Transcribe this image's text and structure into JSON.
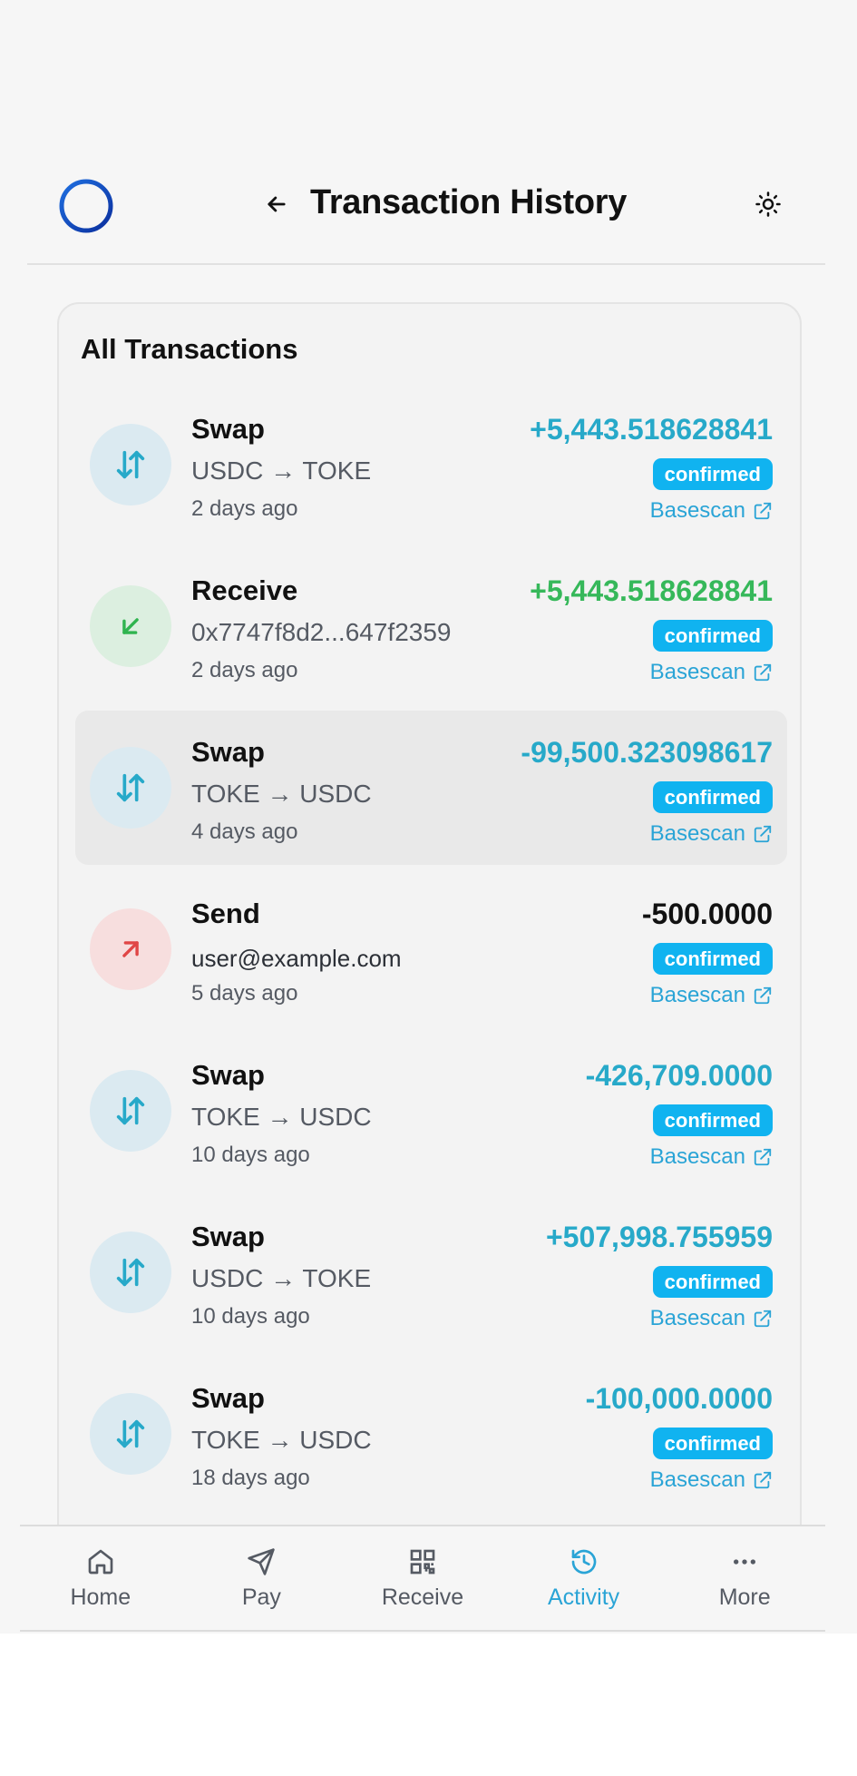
{
  "header": {
    "title": "Transaction History",
    "logo_icon": "token-logo-icon",
    "back_icon": "arrow-left-icon",
    "theme_icon": "sun-icon"
  },
  "card": {
    "title": "All Transactions"
  },
  "colors": {
    "accent": "#2aa4d6",
    "positive": "#36b85a",
    "swap_amount": "#27a9c9",
    "status_badge": "#10b3f0",
    "send_icon": "#e04646",
    "receive_icon": "#2fb44f"
  },
  "transactions": [
    {
      "type": "Swap",
      "detail": "USDC → TOKE",
      "time": "2 days ago",
      "amount": "+5,443.518628841",
      "status": "confirmed",
      "link": "Basescan",
      "icon": "swap-arrows-icon"
    },
    {
      "type": "Receive",
      "detail": "0x7747f8d2...647f2359",
      "time": "2 days ago",
      "amount": "+5,443.518628841",
      "status": "confirmed",
      "link": "Basescan",
      "icon": "arrow-down-left-icon"
    },
    {
      "type": "Swap",
      "detail": "TOKE → USDC",
      "time": "4 days ago",
      "amount": "-99,500.323098617",
      "status": "confirmed",
      "link": "Basescan",
      "icon": "swap-arrows-icon"
    },
    {
      "type": "Send",
      "detail": "user@example.com",
      "time": "5 days ago",
      "amount": "-500.0000",
      "status": "confirmed",
      "link": "Basescan",
      "icon": "arrow-up-right-icon"
    },
    {
      "type": "Swap",
      "detail": "TOKE → USDC",
      "time": "10 days ago",
      "amount": "-426,709.0000",
      "status": "confirmed",
      "link": "Basescan",
      "icon": "swap-arrows-icon"
    },
    {
      "type": "Swap",
      "detail": "USDC → TOKE",
      "time": "10 days ago",
      "amount": "+507,998.755959",
      "status": "confirmed",
      "link": "Basescan",
      "icon": "swap-arrows-icon"
    },
    {
      "type": "Swap",
      "detail": "TOKE → USDC",
      "time": "18 days ago",
      "amount": "-100,000.0000",
      "status": "confirmed",
      "link": "Basescan",
      "icon": "swap-arrows-icon"
    }
  ],
  "nav": {
    "items": [
      {
        "label": "Home",
        "icon": "home-icon"
      },
      {
        "label": "Pay",
        "icon": "send-plane-icon"
      },
      {
        "label": "Receive",
        "icon": "qr-code-icon"
      },
      {
        "label": "Activity",
        "icon": "history-icon",
        "active": true
      },
      {
        "label": "More",
        "icon": "more-dots-icon"
      }
    ]
  }
}
